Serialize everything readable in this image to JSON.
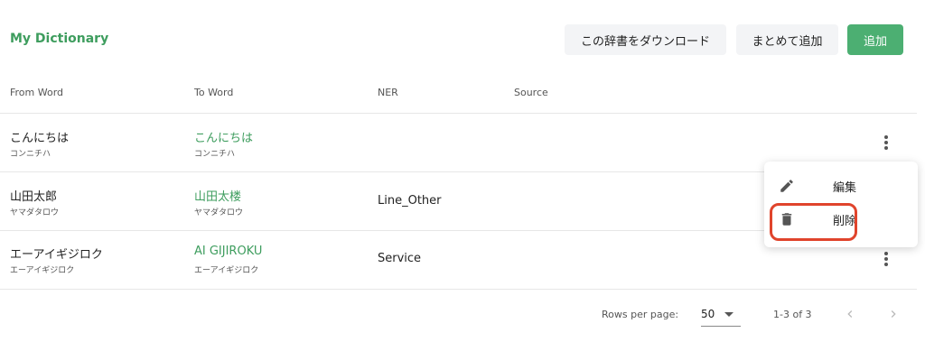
{
  "header": {
    "title": "My Dictionary",
    "download_label": "この辞書をダウンロード",
    "bulk_add_label": "まとめて追加",
    "add_label": "追加"
  },
  "table": {
    "columns": [
      "From Word",
      "To Word",
      "NER",
      "Source"
    ],
    "rows": [
      {
        "from_word": "こんにちは",
        "from_reading": "コンニチハ",
        "to_word": "こんにちは",
        "to_reading": "コンニチハ",
        "ner": "",
        "source": ""
      },
      {
        "from_word": "山田太郎",
        "from_reading": "ヤマダタロウ",
        "to_word": "山田太楼",
        "to_reading": "ヤマダタロウ",
        "ner": "Line_Other",
        "source": ""
      },
      {
        "from_word": "エーアイギジロク",
        "from_reading": "エーアイギジロク",
        "to_word": "AI GIJIROKU",
        "to_reading": "エーアイギジロク",
        "ner": "Service",
        "source": ""
      }
    ]
  },
  "context_menu": {
    "edit_label": "編集",
    "delete_label": "削除",
    "edit_icon": "pencil-icon",
    "delete_icon": "trash-icon"
  },
  "footer": {
    "rows_per_page_label": "Rows per page:",
    "rows_per_page_value": "50",
    "range_label": "1-3 of 3"
  },
  "colors": {
    "accent_green": "#3e9d5e",
    "add_button_bg": "#4caf72",
    "highlight_red": "#e0442c"
  }
}
